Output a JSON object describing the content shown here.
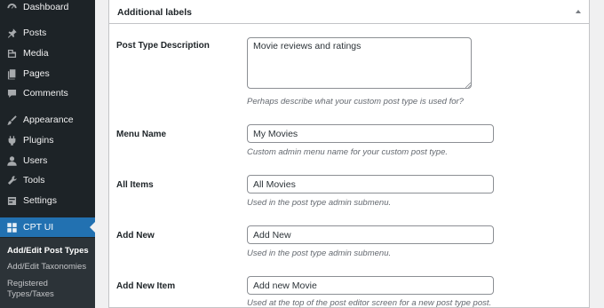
{
  "sidebar": {
    "items": [
      {
        "label": "Dashboard",
        "icon": "dashboard-icon"
      },
      {
        "label": "Posts",
        "icon": "pin-icon"
      },
      {
        "label": "Media",
        "icon": "media-icon"
      },
      {
        "label": "Pages",
        "icon": "pages-icon"
      },
      {
        "label": "Comments",
        "icon": "comment-icon"
      },
      {
        "label": "Appearance",
        "icon": "brush-icon"
      },
      {
        "label": "Plugins",
        "icon": "plug-icon"
      },
      {
        "label": "Users",
        "icon": "user-icon"
      },
      {
        "label": "Tools",
        "icon": "wrench-icon"
      },
      {
        "label": "Settings",
        "icon": "settings-icon"
      },
      {
        "label": "CPT UI",
        "icon": "cptui-icon"
      }
    ],
    "submenu": [
      {
        "label": "Add/Edit Post Types"
      },
      {
        "label": "Add/Edit Taxonomies"
      },
      {
        "label": "Registered"
      },
      {
        "label": "Types/Taxes"
      }
    ]
  },
  "panel": {
    "title": "Additional labels"
  },
  "fields": {
    "description": {
      "label": "Post Type Description",
      "value": "Movie reviews and ratings",
      "help": "Perhaps describe what your custom post type is used for?"
    },
    "menu_name": {
      "label": "Menu Name",
      "value": "My Movies",
      "help": "Custom admin menu name for your custom post type."
    },
    "all_items": {
      "label": "All Items",
      "value": "All Movies",
      "help": "Used in the post type admin submenu."
    },
    "add_new": {
      "label": "Add New",
      "value": "Add New",
      "help": "Used in the post type admin submenu."
    },
    "add_new_item": {
      "label": "Add New Item",
      "value": "Add new Movie",
      "help": "Used at the top of the post editor screen for a new post type post."
    }
  },
  "colors": {
    "sidebar_bg": "#1d2327",
    "active_bg": "#2271b1",
    "submenu_bg": "#2c3338",
    "help_text": "#646970"
  }
}
